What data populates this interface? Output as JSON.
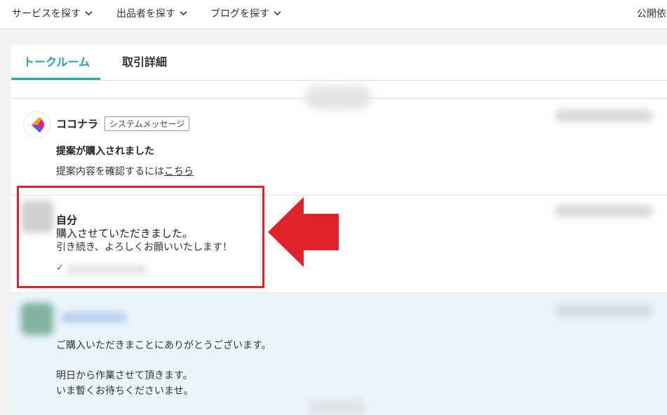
{
  "nav": {
    "items": [
      {
        "label": "サービスを探す"
      },
      {
        "label": "出品者を探す"
      },
      {
        "label": "ブログを探す"
      }
    ],
    "right_label": "公開依"
  },
  "tabs": [
    {
      "label": "トークルーム",
      "active": true
    },
    {
      "label": "取引詳細",
      "active": false
    }
  ],
  "messages": {
    "system": {
      "sender": "ココナラ",
      "badge": "システムメッセージ",
      "title": "提案が購入されました",
      "body_prefix": "提案内容を確認するには",
      "link": "こちら"
    },
    "self": {
      "sender": "自分",
      "line1": "購入させていただきました。",
      "line2": "引き続き、よろしくお願いいたします！",
      "check": "✓"
    },
    "seller": {
      "line1": "ご購入いただきまことにありがとうございます。",
      "line2": "明日から作業させて頂きます。",
      "line3": "いま暫くお待ちくださいませ。"
    }
  },
  "colors": {
    "accent": "#21a99a",
    "highlight": "#e0222a",
    "seller_bg": "#eaf4fb"
  }
}
